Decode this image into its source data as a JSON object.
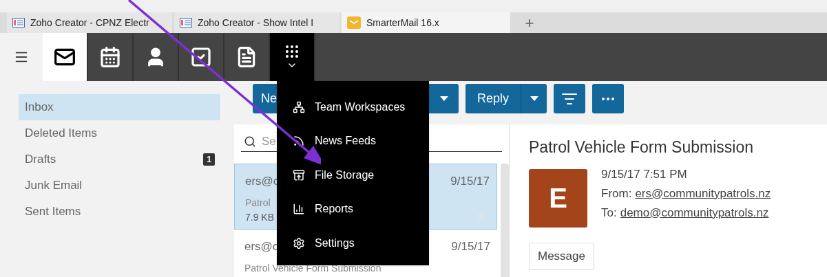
{
  "browser_tabs": [
    {
      "label": "Zoho Creator - CPNZ Electr",
      "kind": "zoho",
      "selected": false
    },
    {
      "label": "Zoho Creator - Show Intel I",
      "kind": "zoho",
      "selected": false
    },
    {
      "label": "SmarterMail 16.x",
      "kind": "mail",
      "selected": true
    }
  ],
  "new_tab": "+",
  "app_nav": [
    {
      "kind": "mail",
      "selected": true
    },
    {
      "kind": "calendar",
      "selected": false
    },
    {
      "kind": "contacts",
      "selected": false
    },
    {
      "kind": "tasks",
      "selected": false
    },
    {
      "kind": "notes",
      "selected": false
    },
    {
      "kind": "apps",
      "selected": false,
      "expanded": true
    }
  ],
  "folders": [
    {
      "label": "Inbox",
      "selected": true
    },
    {
      "label": "Deleted Items",
      "selected": false
    },
    {
      "label": "Drafts",
      "selected": false,
      "count": "1"
    },
    {
      "label": "Junk Email",
      "selected": false
    },
    {
      "label": "Sent Items",
      "selected": false
    }
  ],
  "toolbar": {
    "new_button": "Ne",
    "reply_button": "Reply"
  },
  "search": {
    "placeholder": "Se"
  },
  "messages": [
    {
      "sender": "ers@c",
      "date": "9/15/17",
      "subject": "Patrol",
      "size": "7.9 KB",
      "selected": true
    },
    {
      "sender": "ers@c",
      "date": "9/15/17",
      "subject": "Patrol Vehicle Form Submission",
      "selected": false
    }
  ],
  "reading_pane": {
    "subject": "Patrol Vehicle Form Submission",
    "avatar_letter": "E",
    "datetime": "9/15/17 7:51 PM",
    "from_label": "From:",
    "from": "ers@communitypatrols.nz",
    "to_label": "To:",
    "to": "demo@communitypatrols.nz",
    "tab": "Message"
  },
  "apps_menu": [
    {
      "label": "Team Workspaces",
      "kind": "workspaces"
    },
    {
      "label": "News Feeds",
      "kind": "feeds"
    },
    {
      "label": "File Storage",
      "kind": "storage"
    },
    {
      "label": "Reports",
      "kind": "reports"
    },
    {
      "label": "Settings",
      "kind": "settings"
    }
  ]
}
